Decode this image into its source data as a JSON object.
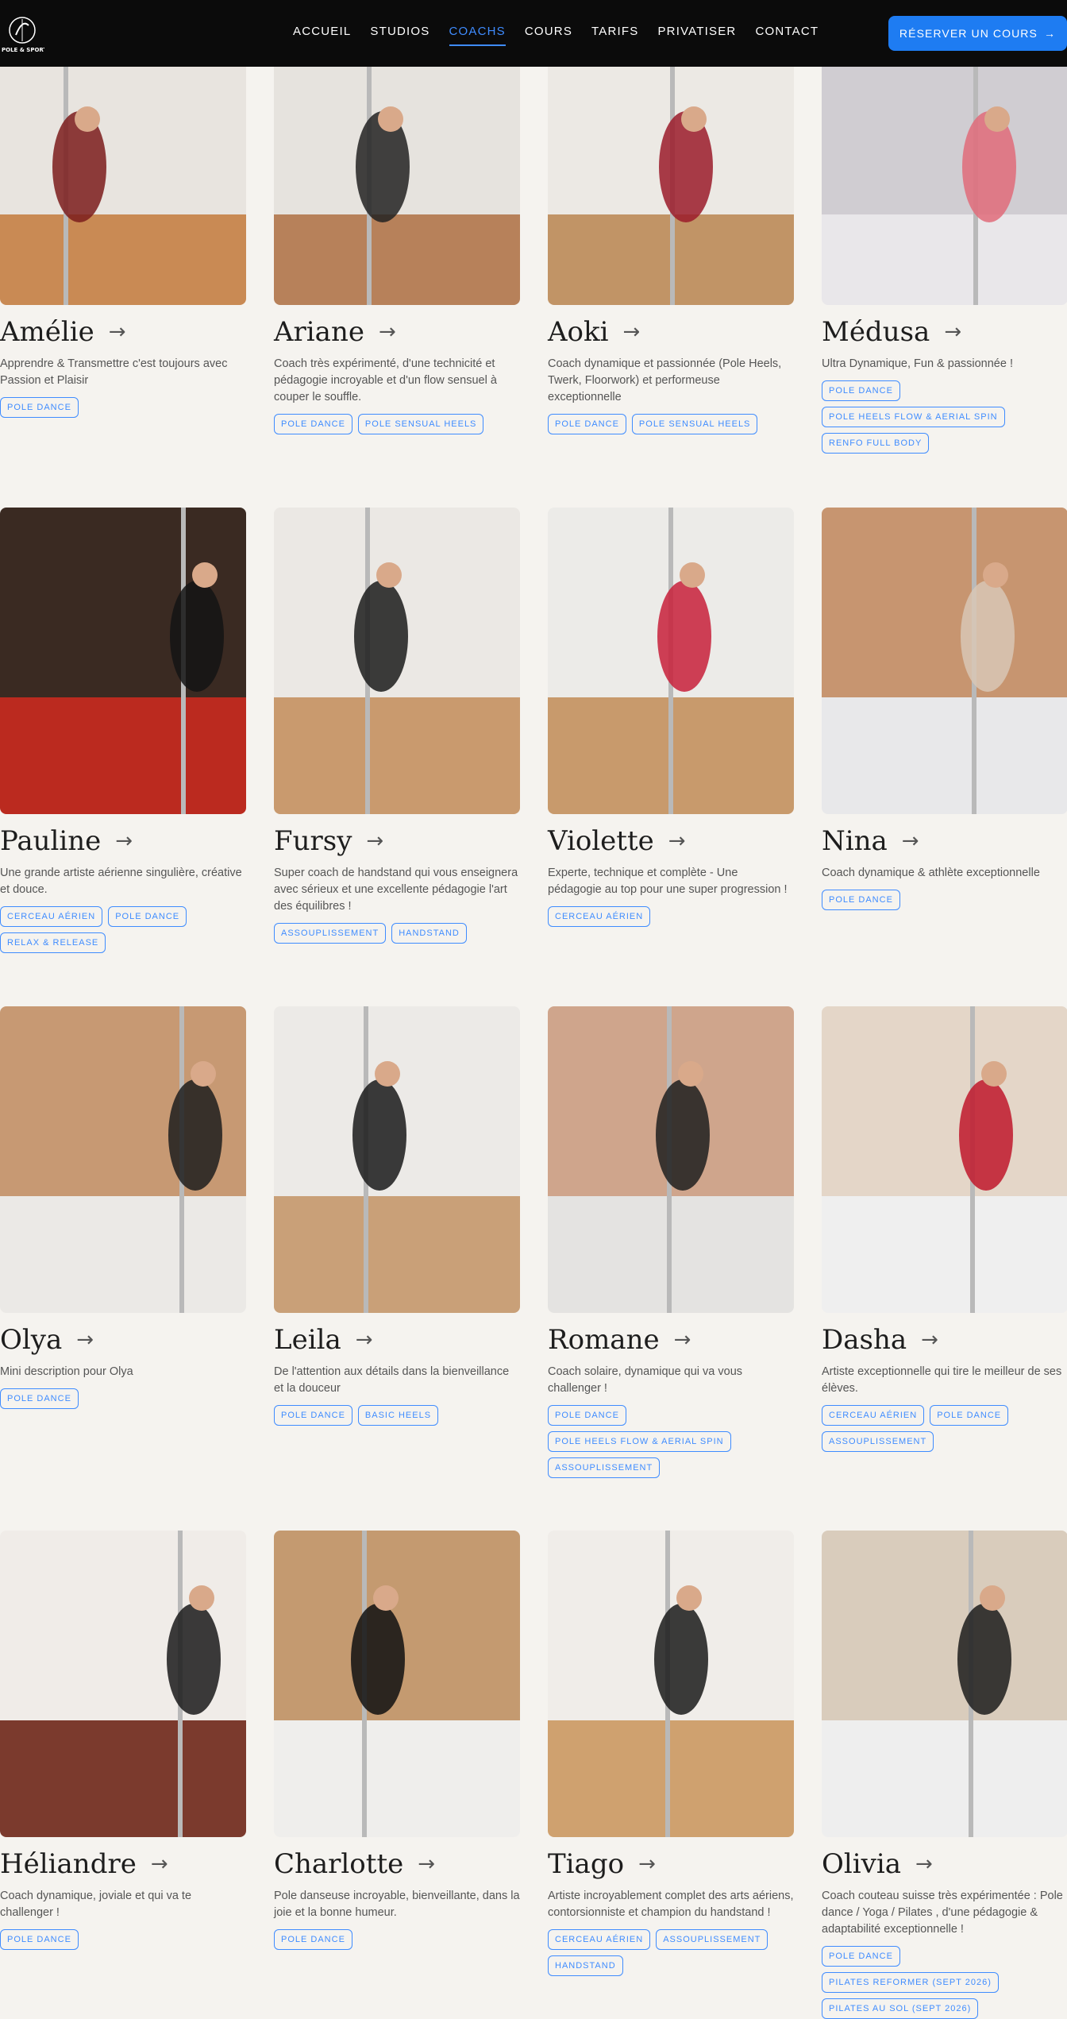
{
  "header": {
    "logo_text": "POLE & SPORT",
    "nav": [
      {
        "label": "ACCUEIL",
        "active": false
      },
      {
        "label": "STUDIOS",
        "active": false
      },
      {
        "label": "COACHS",
        "active": true
      },
      {
        "label": "COURS",
        "active": false
      },
      {
        "label": "TARIFS",
        "active": false
      },
      {
        "label": "PRIVATISER",
        "active": false
      },
      {
        "label": "CONTACT",
        "active": false
      }
    ],
    "cta_label": "RÉSERVER UN COURS",
    "cta_icon": "arrow-right-icon"
  },
  "colors": {
    "accent": "#3f8cff",
    "cta": "#1e7cf2",
    "nav_bg": "#0b0b0b",
    "page_bg": "#f5f3ef"
  },
  "coaches": [
    {
      "name": "Amélie",
      "description": "Apprendre & Transmettre c'est toujours avec Passion et Plaisir",
      "tags": [
        "POLE DANCE"
      ]
    },
    {
      "name": "Ariane",
      "description": "Coach très expérimenté, d'une technicité et pédagogie incroyable et d'un flow sensuel à couper le souffle.",
      "tags": [
        "POLE DANCE",
        "POLE SENSUAL HEELS"
      ]
    },
    {
      "name": "Aoki",
      "description": "Coach dynamique et passionnée (Pole Heels, Twerk, Floorwork) et performeuse exceptionnelle",
      "tags": [
        "POLE DANCE",
        "POLE SENSUAL HEELS"
      ]
    },
    {
      "name": "Médusa",
      "description": "Ultra Dynamique, Fun & passionnée !",
      "tags": [
        "POLE DANCE",
        "POLE HEELS FLOW & AERIAL SPIN",
        "RENFO FULL BODY"
      ]
    },
    {
      "name": "Pauline",
      "description": "Une grande artiste aérienne singulière, créative et douce.",
      "tags": [
        "CERCEAU AÉRIEN",
        "POLE DANCE",
        "RELAX & RELEASE"
      ]
    },
    {
      "name": "Fursy",
      "description": "Super coach de handstand qui vous enseignera avec sérieux et une excellente pédagogie l'art des équilibres !",
      "tags": [
        "ASSOUPLISSEMENT",
        "HANDSTAND"
      ]
    },
    {
      "name": "Violette",
      "description": "Experte, technique et complète - Une pédagogie au top pour une super progression !",
      "tags": [
        "CERCEAU AÉRIEN"
      ]
    },
    {
      "name": "Nina",
      "description": "Coach dynamique & athlète exceptionnelle",
      "tags": [
        "POLE DANCE"
      ]
    },
    {
      "name": "Olya",
      "description": "Mini description pour Olya",
      "tags": [
        "POLE DANCE"
      ]
    },
    {
      "name": "Leila",
      "description": "De l'attention aux détails dans la bienveillance et la douceur",
      "tags": [
        "POLE DANCE",
        "BASIC HEELS"
      ]
    },
    {
      "name": "Romane",
      "description": "Coach solaire, dynamique qui va vous challenger !",
      "tags": [
        "POLE DANCE",
        "POLE HEELS FLOW & AERIAL SPIN",
        "ASSOUPLISSEMENT"
      ]
    },
    {
      "name": "Dasha",
      "description": "Artiste exceptionnelle qui tire le meilleur de ses élèves.",
      "tags": [
        "CERCEAU AÉRIEN",
        "POLE DANCE",
        "ASSOUPLISSEMENT"
      ]
    },
    {
      "name": "Héliandre",
      "description": "Coach dynamique, joviale et qui va te challenger !",
      "tags": [
        "POLE DANCE"
      ]
    },
    {
      "name": "Charlotte",
      "description": "Pole danseuse incroyable, bienveillante, dans la joie et la bonne humeur.",
      "tags": [
        "POLE DANCE"
      ]
    },
    {
      "name": "Tiago",
      "description": "Artiste incroyablement complet des arts aériens, contorsionniste et champion du handstand !",
      "tags": [
        "CERCEAU AÉRIEN",
        "ASSOUPLISSEMENT",
        "HANDSTAND"
      ]
    },
    {
      "name": "Olivia",
      "description": "Coach couteau suisse très expérimentée : Pole dance / Yoga / Pilates , d'une pédagogie & adaptabilité exceptionnelle !",
      "tags": [
        "POLE DANCE",
        "PILATES REFORMER (SEPT 2026)",
        "PILATES AU SOL (SEPT 2026)"
      ]
    }
  ]
}
